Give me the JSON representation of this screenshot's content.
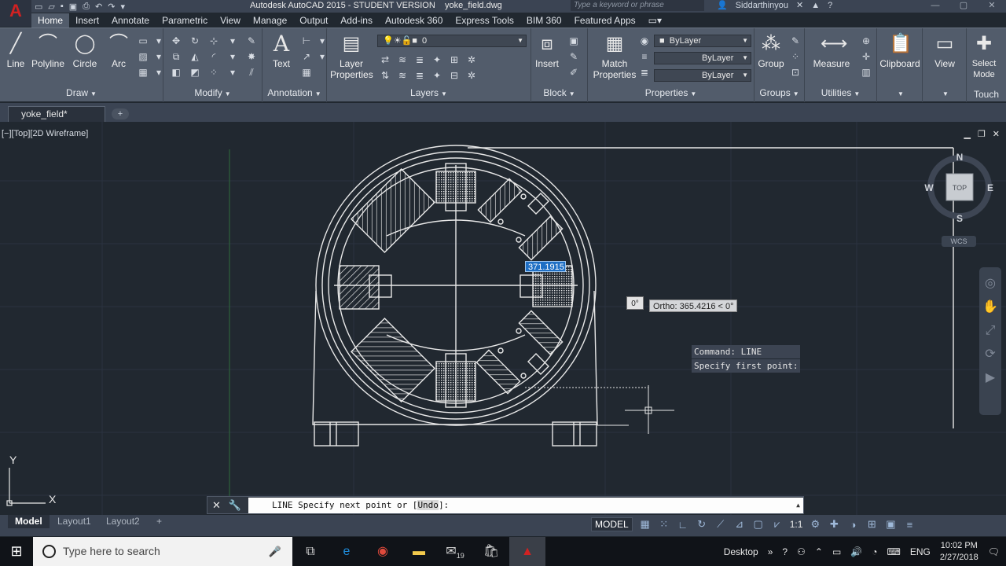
{
  "app": {
    "title": "Autodesk AutoCAD 2015 - STUDENT VERSION",
    "filename": "yoke_field.dwg",
    "logo": "A",
    "search_placeholder": "Type a keyword or phrase",
    "user": "Siddarthinyou"
  },
  "ribbon_tabs": [
    "Home",
    "Insert",
    "Annotate",
    "Parametric",
    "View",
    "Manage",
    "Output",
    "Add-ins",
    "Autodesk 360",
    "Express Tools",
    "BIM 360",
    "Featured Apps"
  ],
  "panels": {
    "draw": {
      "title": "Draw",
      "tools": [
        "Line",
        "Polyline",
        "Circle",
        "Arc"
      ]
    },
    "modify": {
      "title": "Modify"
    },
    "annotation": {
      "title": "Annotation",
      "text": "Text"
    },
    "layers": {
      "title": "Layers",
      "layer_properties": "Layer Properties",
      "current_layer": "0"
    },
    "block": {
      "title": "Block",
      "insert": "Insert"
    },
    "properties": {
      "title": "Properties",
      "match": "Match Properties",
      "color": "ByLayer",
      "linetype": "ByLayer",
      "lineweight": "ByLayer"
    },
    "groups": {
      "title": "Groups",
      "group": "Group"
    },
    "utilities": {
      "title": "Utilities",
      "measure": "Measure"
    },
    "clipboard": {
      "label": "Clipboard"
    },
    "view": {
      "label": "View"
    },
    "select_mode": {
      "label": "Select Mode"
    },
    "touch": {
      "label": "Touch"
    }
  },
  "doc_tab": "yoke_field*",
  "viewport": {
    "label": "[−][Top][2D Wireframe]",
    "compass": {
      "n": "N",
      "s": "S",
      "e": "E",
      "w": "W",
      "center": "TOP"
    },
    "wcs": "WCS",
    "ucs": {
      "x": "X",
      "y": "Y"
    }
  },
  "dynamic_input": {
    "length": "371.1915",
    "angle": "0°",
    "ortho_tooltip": "Ortho: 365.4216 < 0°"
  },
  "command": {
    "history": [
      "Command: LINE",
      "Specify first point:"
    ],
    "prompt_prefix": "LINE Specify next point or [",
    "prompt_option": "Undo",
    "prompt_suffix": "]:"
  },
  "layout_tabs": [
    "Model",
    "Layout1",
    "Layout2"
  ],
  "status": {
    "model": "MODEL",
    "scale": "1:1"
  },
  "taskbar": {
    "search": "Type here to search",
    "desktop": "Desktop",
    "lang": "ENG",
    "time": "10:02 PM",
    "date": "2/27/2018",
    "mail_badge": "19"
  }
}
